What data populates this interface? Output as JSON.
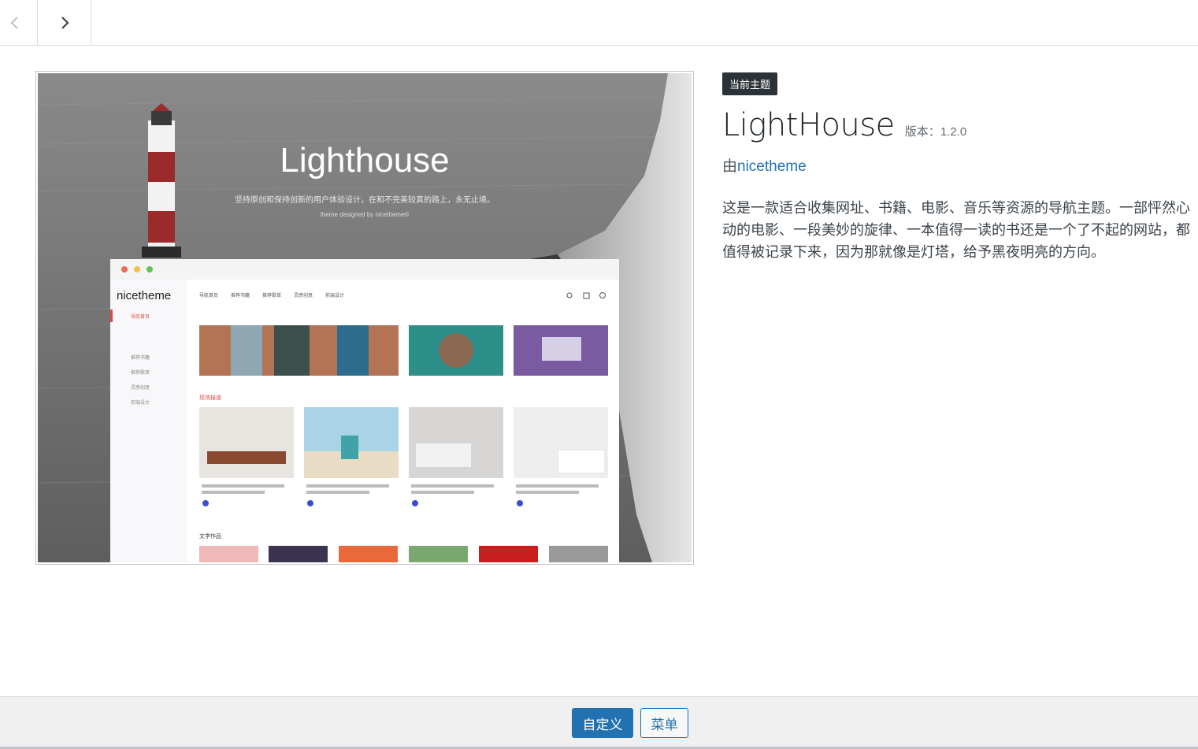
{
  "nav": {
    "prev_icon": "chevron-left-icon",
    "next_icon": "chevron-right-icon"
  },
  "theme": {
    "badge": "当前主题",
    "name": "LightHouse",
    "version_label": "版本：",
    "version": "1.2.0",
    "author_prefix": "由",
    "author": "nicetheme",
    "description": "这是一款适合收集网址、书籍、电影、音乐等资源的导航主题。一部怦然心动的电影、一段美妙的旋律、一本值得一读的书还是一个了不起的网站，都值得被记录下来，因为那就像是灯塔，给予黑夜明亮的方向。"
  },
  "screenshot": {
    "title": "Lighthouse",
    "subtitle": "坚持原创和保持创新的用户体验设计，在和不完美较真的路上，永无止境。",
    "tagline": "theme designed by nicetheme®",
    "brand": "nicetheme",
    "menu": [
      "导航首页",
      "推荐书籍",
      "推荐歌单",
      "灵感创意",
      "前端设计"
    ],
    "sidebar": [
      "导航首页",
      "推荐书籍",
      "推荐歌单",
      "灵感创意",
      "前端设计"
    ],
    "section1": "现场报道",
    "section2": "文学作品"
  },
  "footer": {
    "customize_label": "自定义",
    "menu_label": "菜单"
  },
  "colors": {
    "accent": "#2271b1",
    "badge_bg": "#2c3338"
  }
}
